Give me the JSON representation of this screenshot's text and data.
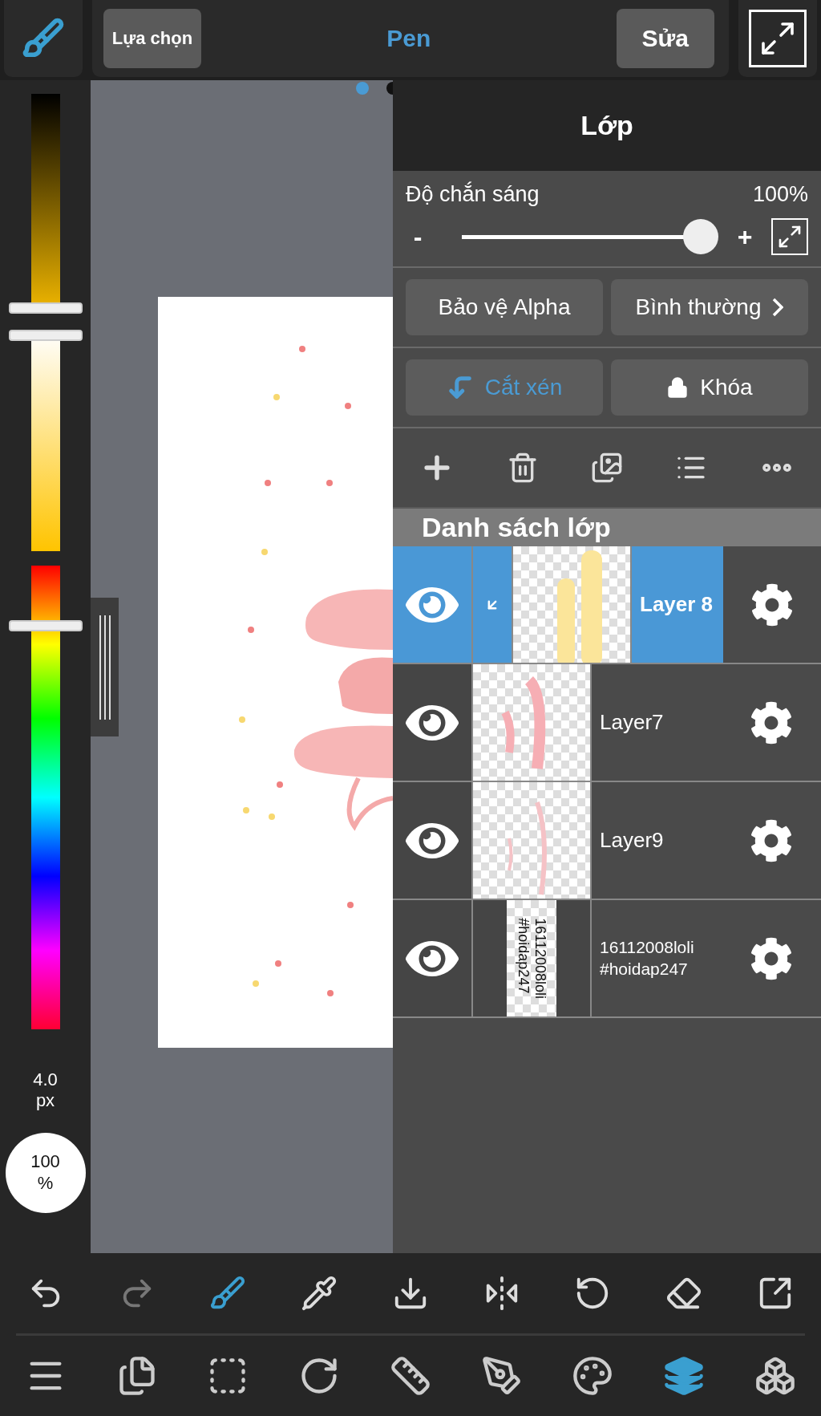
{
  "top_bar": {
    "selection_button": "Lựa chọn",
    "tool_name": "Pen",
    "edit_button": "Sửa"
  },
  "color_bar": {
    "sliders": [
      {
        "kind": "shade"
      },
      {
        "kind": "tint"
      },
      {
        "kind": "hue"
      }
    ],
    "brush_size": "4.0",
    "brush_unit": "px",
    "brush_opacity": "100",
    "opacity_unit": "%"
  },
  "page_dots": [
    {
      "selected": true
    },
    {
      "selected": false
    }
  ],
  "layer_panel": {
    "title": "Lớp",
    "opacity_label": "Độ chắn sáng",
    "opacity_value": "100%",
    "opacity_slider": {
      "level": 1
    },
    "minus": "-",
    "plus": "+",
    "alpha_protect": "Bảo vệ Alpha",
    "blend_mode": "Bình thường",
    "clipping": {
      "label": "Cắt xén",
      "on": true
    },
    "lock": {
      "label": "Khóa",
      "on": false
    },
    "list_title": "Danh sách lớp",
    "layers": [
      {
        "name": "Layer 8",
        "selected": true,
        "visible": true,
        "clipped": true,
        "thumbnail": {
          "kind": "yellow"
        }
      },
      {
        "name": "Layer7",
        "selected": false,
        "visible": true,
        "clipped": false,
        "thumbnail": {
          "kind": "pink"
        }
      },
      {
        "name": "Layer9",
        "selected": false,
        "visible": true,
        "clipped": false,
        "thumbnail": {
          "kind": "pink-light"
        }
      },
      {
        "name": "16112008loli\n#hoidap247",
        "selected": false,
        "visible": true,
        "clipped": false,
        "thumbnail": {
          "kind": "text",
          "text": "16112008loli\n#hoidap247"
        }
      }
    ]
  },
  "action_bar": [
    {
      "disabled": false
    },
    {
      "disabled": true
    },
    {
      "disabled": false
    },
    {
      "disabled": false
    },
    {
      "disabled": false
    },
    {
      "disabled": false
    },
    {
      "disabled": false
    },
    {
      "disabled": false
    },
    {
      "disabled": false
    }
  ],
  "menu_bar": [
    {
      "selected": false
    },
    {
      "selected": false
    },
    {
      "selected": false
    },
    {
      "selected": false
    },
    {
      "selected": false
    },
    {
      "selected": false
    },
    {
      "selected": false
    },
    {
      "selected": true
    },
    {
      "selected": false
    }
  ]
}
